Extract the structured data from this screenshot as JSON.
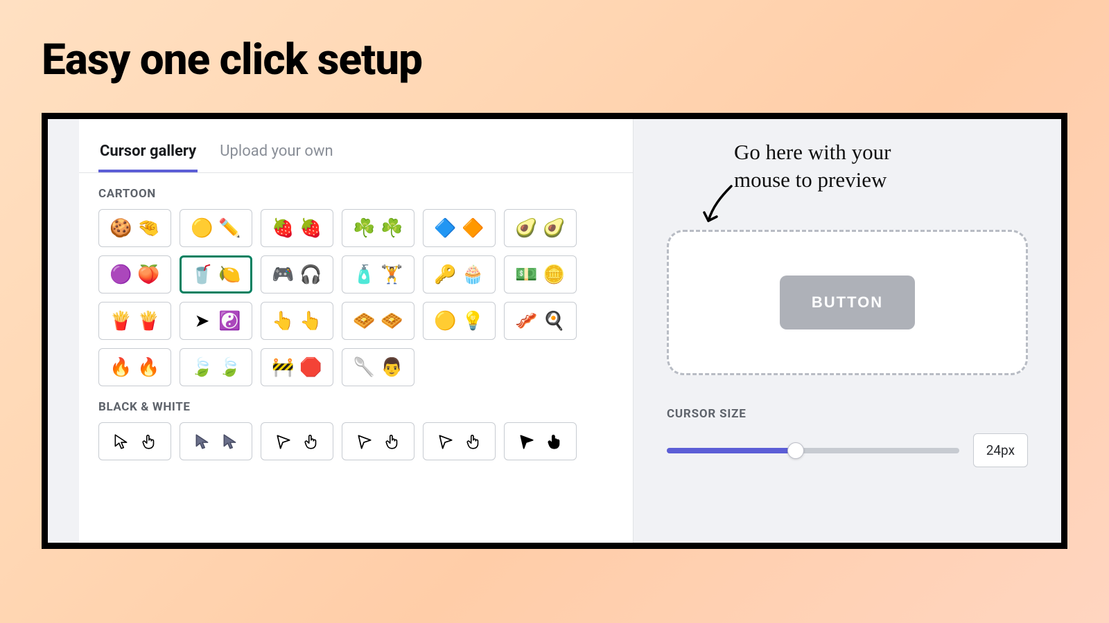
{
  "page_title": "Easy one click setup",
  "tabs": {
    "gallery": "Cursor gallery",
    "upload": "Upload your own"
  },
  "sections": {
    "cartoon": {
      "label": "CARTOON",
      "items": [
        {
          "id": "cookie",
          "a": "🍪",
          "b": "🤏"
        },
        {
          "id": "pencil",
          "a": "🟡",
          "b": "✏️"
        },
        {
          "id": "strawberry",
          "a": "🍓",
          "b": "🍓"
        },
        {
          "id": "clover",
          "a": "☘️",
          "b": "☘️"
        },
        {
          "id": "prism",
          "a": "🔷",
          "b": "🔶"
        },
        {
          "id": "avocado",
          "a": "🥑",
          "b": "🥑"
        },
        {
          "id": "peach",
          "a": "🟣",
          "b": "🍑"
        },
        {
          "id": "drinks",
          "a": "🥤",
          "b": "🍋",
          "selected": true
        },
        {
          "id": "gamer",
          "a": "🎮",
          "b": "🎧"
        },
        {
          "id": "fitness",
          "a": "🧴",
          "b": "🏋️"
        },
        {
          "id": "dessert",
          "a": "🔑",
          "b": "🧁"
        },
        {
          "id": "money",
          "a": "💵",
          "b": "🪙"
        },
        {
          "id": "fries",
          "a": "🍟",
          "b": "🍟"
        },
        {
          "id": "yinyang",
          "a": "➤",
          "b": "☯️"
        },
        {
          "id": "hands",
          "a": "👆",
          "b": "👆"
        },
        {
          "id": "waffle",
          "a": "🧇",
          "b": "🧇"
        },
        {
          "id": "bulb",
          "a": "🟡",
          "b": "💡"
        },
        {
          "id": "bacon",
          "a": "🥓",
          "b": "🍳"
        },
        {
          "id": "fire",
          "a": "🔥",
          "b": "🔥"
        },
        {
          "id": "leaf",
          "a": "🍃",
          "b": "🍃"
        },
        {
          "id": "stop",
          "a": "🚧",
          "b": "🛑"
        },
        {
          "id": "spatula",
          "a": "🥄",
          "b": "👨"
        }
      ]
    },
    "bw": {
      "label": "BLACK & WHITE",
      "items": [
        {
          "id": "bw1"
        },
        {
          "id": "bw2"
        },
        {
          "id": "bw3"
        },
        {
          "id": "bw4"
        },
        {
          "id": "bw5"
        },
        {
          "id": "bw6"
        }
      ]
    }
  },
  "annotation": {
    "line1": "Go here with your",
    "line2": "mouse to preview"
  },
  "preview": {
    "button_label": "BUTTON"
  },
  "cursor_size": {
    "label": "CURSOR SIZE",
    "value": "24px",
    "percent": 44
  }
}
